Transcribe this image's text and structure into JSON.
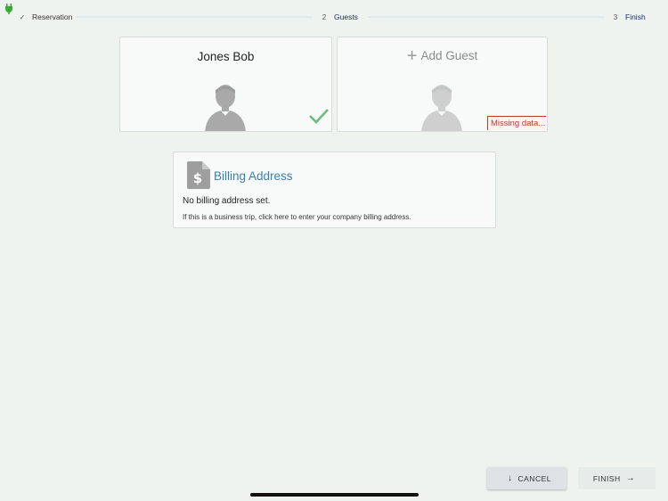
{
  "stepper": {
    "steps": [
      {
        "marker": "✓",
        "label": "Reservation"
      },
      {
        "marker": "2",
        "label": "Guests"
      },
      {
        "marker": "3",
        "label": "Finish"
      }
    ]
  },
  "guests": [
    {
      "name": "Jones Bob",
      "status": "complete"
    },
    {
      "add_label": "Add Guest",
      "warning": "Missing data..."
    }
  ],
  "billing": {
    "title": "Billing Address",
    "empty_text": "No billing address set.",
    "hint": "If this is a business trip, click here to enter your company billing address."
  },
  "actions": {
    "cancel_label": "CANCEL",
    "finish_label": "FINISH"
  },
  "colors": {
    "background": "#eef3ef",
    "accent_blue": "#3b7fb0",
    "success_green": "#6dbb7b",
    "error_red": "#c0392b"
  }
}
